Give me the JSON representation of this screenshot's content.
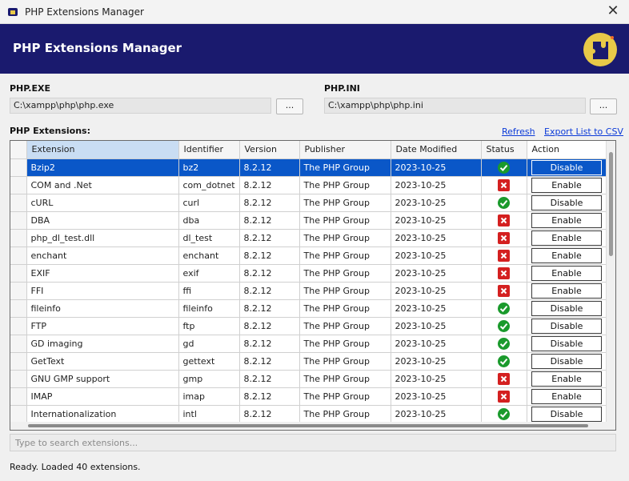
{
  "window": {
    "title": "PHP Extensions Manager"
  },
  "banner": {
    "title": "PHP Extensions Manager"
  },
  "php_exe": {
    "label": "PHP.EXE",
    "value": "C:\\xampp\\php\\php.exe",
    "browse_label": "..."
  },
  "php_ini": {
    "label": "PHP.INI",
    "value": "C:\\xampp\\php\\php.ini",
    "browse_label": "..."
  },
  "extensions": {
    "label": "PHP Extensions:",
    "refresh_label": "Refresh",
    "export_label": "Export List to CSV",
    "columns": [
      "Extension",
      "Identifier",
      "Version",
      "Publisher",
      "Date Modified",
      "Status",
      "Action"
    ],
    "rows": [
      {
        "extension": "Bzip2",
        "identifier": "bz2",
        "version": "8.2.12",
        "publisher": "The PHP Group",
        "date": "2023-10-25",
        "status": "enabled",
        "action": "Disable"
      },
      {
        "extension": "COM and .Net",
        "identifier": "com_dotnet",
        "version": "8.2.12",
        "publisher": "The PHP Group",
        "date": "2023-10-25",
        "status": "disabled",
        "action": "Enable"
      },
      {
        "extension": "cURL",
        "identifier": "curl",
        "version": "8.2.12",
        "publisher": "The PHP Group",
        "date": "2023-10-25",
        "status": "enabled",
        "action": "Disable"
      },
      {
        "extension": "DBA",
        "identifier": "dba",
        "version": "8.2.12",
        "publisher": "The PHP Group",
        "date": "2023-10-25",
        "status": "disabled",
        "action": "Enable"
      },
      {
        "extension": "php_dl_test.dll",
        "identifier": "dl_test",
        "version": "8.2.12",
        "publisher": "The PHP Group",
        "date": "2023-10-25",
        "status": "disabled",
        "action": "Enable"
      },
      {
        "extension": "enchant",
        "identifier": "enchant",
        "version": "8.2.12",
        "publisher": "The PHP Group",
        "date": "2023-10-25",
        "status": "disabled",
        "action": "Enable"
      },
      {
        "extension": "EXIF",
        "identifier": "exif",
        "version": "8.2.12",
        "publisher": "The PHP Group",
        "date": "2023-10-25",
        "status": "disabled",
        "action": "Enable"
      },
      {
        "extension": "FFI",
        "identifier": "ffi",
        "version": "8.2.12",
        "publisher": "The PHP Group",
        "date": "2023-10-25",
        "status": "disabled",
        "action": "Enable"
      },
      {
        "extension": "fileinfo",
        "identifier": "fileinfo",
        "version": "8.2.12",
        "publisher": "The PHP Group",
        "date": "2023-10-25",
        "status": "enabled",
        "action": "Disable"
      },
      {
        "extension": "FTP",
        "identifier": "ftp",
        "version": "8.2.12",
        "publisher": "The PHP Group",
        "date": "2023-10-25",
        "status": "enabled",
        "action": "Disable"
      },
      {
        "extension": "GD imaging",
        "identifier": "gd",
        "version": "8.2.12",
        "publisher": "The PHP Group",
        "date": "2023-10-25",
        "status": "enabled",
        "action": "Disable"
      },
      {
        "extension": "GetText",
        "identifier": "gettext",
        "version": "8.2.12",
        "publisher": "The PHP Group",
        "date": "2023-10-25",
        "status": "enabled",
        "action": "Disable"
      },
      {
        "extension": "GNU GMP support",
        "identifier": "gmp",
        "version": "8.2.12",
        "publisher": "The PHP Group",
        "date": "2023-10-25",
        "status": "disabled",
        "action": "Enable"
      },
      {
        "extension": "IMAP",
        "identifier": "imap",
        "version": "8.2.12",
        "publisher": "The PHP Group",
        "date": "2023-10-25",
        "status": "disabled",
        "action": "Enable"
      },
      {
        "extension": "Internationalization",
        "identifier": "intl",
        "version": "8.2.12",
        "publisher": "The PHP Group",
        "date": "2023-10-25",
        "status": "enabled",
        "action": "Disable"
      }
    ]
  },
  "search": {
    "placeholder": "Type to search extensions..."
  },
  "status": {
    "text": "Ready. Loaded 40 extensions."
  },
  "colors": {
    "banner": "#1a1a6e",
    "selected_row": "#0a57c8",
    "enabled": "#1a9a2c",
    "disabled": "#d42020",
    "link": "#0b3ad8"
  }
}
